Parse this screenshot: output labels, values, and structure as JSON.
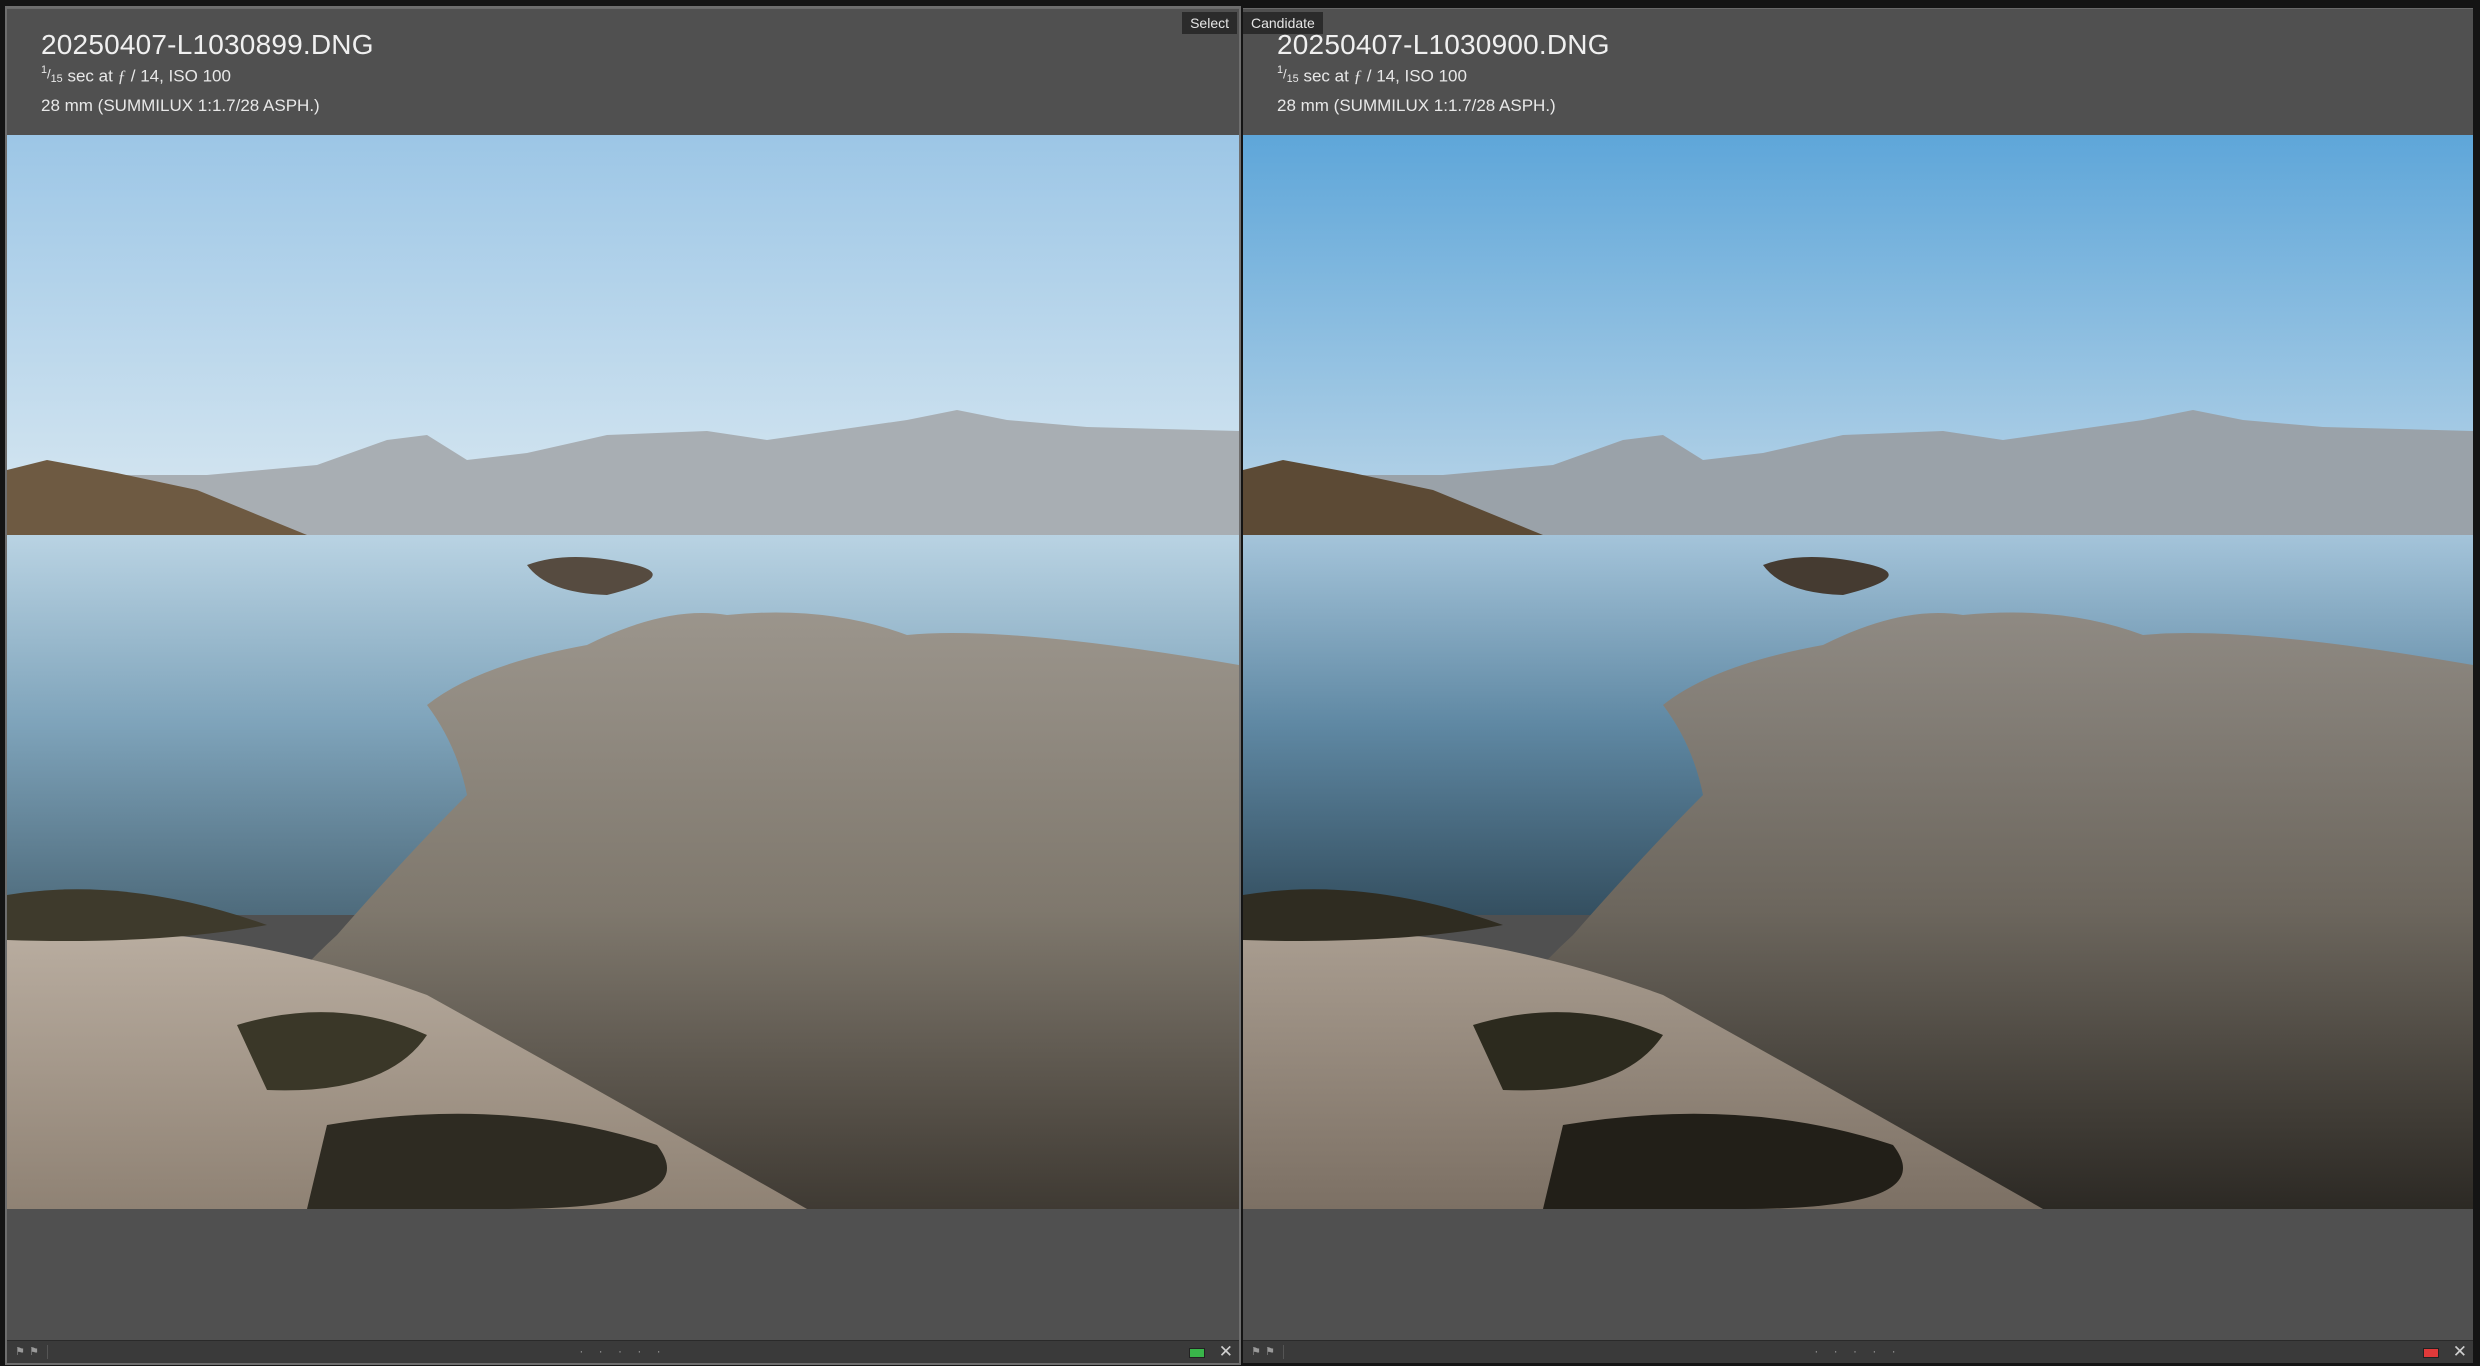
{
  "left": {
    "tag": "Select",
    "filename": "20250407-L1030899.DNG",
    "shutter_numerator": "1",
    "shutter_denominator": "15",
    "exposure_rest": "sec at ",
    "aperture_symbol": "ƒ",
    "aperture_rest": " / 14, ISO 100",
    "lens": "28 mm (SUMMILUX 1:1.7/28 ASPH.)",
    "color_label": "#39b54a",
    "footer_dots": "· · · · ·",
    "close_glyph": "✕"
  },
  "right": {
    "tag": "Candidate",
    "filename": "20250407-L1030900.DNG",
    "shutter_numerator": "1",
    "shutter_denominator": "15",
    "exposure_rest": "sec at ",
    "aperture_symbol": "ƒ",
    "aperture_rest": " / 14, ISO 100",
    "lens": "28 mm (SUMMILUX 1:1.7/28 ASPH.)",
    "color_label": "#e03a3a",
    "footer_dots": "· · · · ·",
    "close_glyph": "✕"
  },
  "icons": {
    "flag_pick": "flag-pick-icon",
    "flag_reject": "flag-reject-icon",
    "close": "close-icon"
  },
  "colors": {
    "left_sky_top": "#9cc6e6",
    "left_sky_bottom": "#d9e8f1",
    "right_sky_top": "#5ea6d9",
    "right_sky_bottom": "#bcd6e8"
  }
}
